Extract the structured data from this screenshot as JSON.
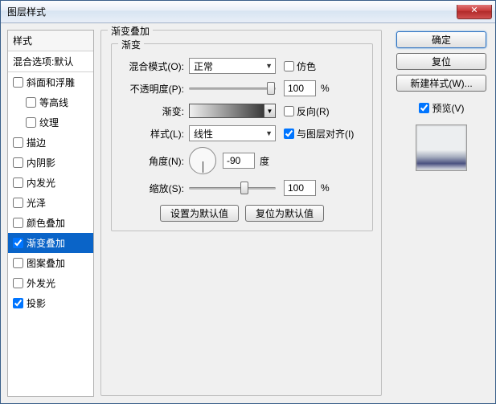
{
  "window": {
    "title": "图层样式"
  },
  "styles": {
    "header": "样式",
    "blend": "混合选项:默认",
    "items": [
      {
        "label": "斜面和浮雕",
        "checked": false,
        "indent": false
      },
      {
        "label": "等高线",
        "checked": false,
        "indent": true
      },
      {
        "label": "纹理",
        "checked": false,
        "indent": true
      },
      {
        "label": "描边",
        "checked": false,
        "indent": false
      },
      {
        "label": "内阴影",
        "checked": false,
        "indent": false
      },
      {
        "label": "内发光",
        "checked": false,
        "indent": false
      },
      {
        "label": "光泽",
        "checked": false,
        "indent": false
      },
      {
        "label": "颜色叠加",
        "checked": false,
        "indent": false
      },
      {
        "label": "渐变叠加",
        "checked": true,
        "indent": false,
        "selected": true
      },
      {
        "label": "图案叠加",
        "checked": false,
        "indent": false
      },
      {
        "label": "外发光",
        "checked": false,
        "indent": false
      },
      {
        "label": "投影",
        "checked": true,
        "indent": false
      }
    ]
  },
  "settings": {
    "outer_legend": "渐变叠加",
    "inner_legend": "渐变",
    "blend_mode": {
      "label": "混合模式(O):",
      "value": "正常"
    },
    "dither": {
      "label": "仿色",
      "checked": false
    },
    "opacity": {
      "label": "不透明度(P):",
      "value": "100",
      "unit": "%"
    },
    "gradient": {
      "label": "渐变:"
    },
    "reverse": {
      "label": "反向(R)",
      "checked": false
    },
    "style": {
      "label": "样式(L):",
      "value": "线性"
    },
    "align": {
      "label": "与图层对齐(I)",
      "checked": true
    },
    "angle": {
      "label": "角度(N):",
      "value": "-90",
      "unit": "度"
    },
    "scale": {
      "label": "缩放(S):",
      "value": "100",
      "unit": "%"
    },
    "reset_btn": "设置为默认值",
    "restore_btn": "复位为默认值"
  },
  "side": {
    "ok": "确定",
    "cancel": "复位",
    "new_style": "新建样式(W)...",
    "preview": {
      "label": "预览(V)",
      "checked": true
    }
  }
}
